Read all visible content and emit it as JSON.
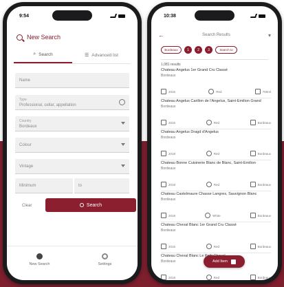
{
  "colors": {
    "accent": "#8b1e2f",
    "band_bottom": "#7e1f2e"
  },
  "left": {
    "status_time": "9:54",
    "header_title": "New Search",
    "tabs": [
      {
        "label": "Search",
        "icon": "magnifier-icon",
        "active": true
      },
      {
        "label": "Advanced list",
        "icon": "list-icon",
        "active": false
      }
    ],
    "fields": [
      {
        "placeholder": "Name"
      },
      {
        "label": "Type",
        "value": "Professional, cellar, appellation"
      },
      {
        "label": "Country",
        "value": "Bordeaux"
      },
      {
        "placeholder": "Colour"
      },
      {
        "placeholder": "Vintage"
      }
    ],
    "range": {
      "from": "Minimum",
      "to": "to"
    },
    "clear_label": "Clear",
    "search_label": "Search",
    "nav": [
      {
        "label": "New Search",
        "icon": "search-icon"
      },
      {
        "label": "Settings",
        "icon": "gear-icon"
      }
    ]
  },
  "right": {
    "status_time": "10:38",
    "title": "Search Results",
    "chips": [
      "Bordeaux",
      "1",
      "2",
      "3",
      "Search to"
    ],
    "results_count": "1,081 results",
    "results": [
      {
        "name": "Chateau Angelus 1er Grand Cru Classé",
        "region": "Bordeaux",
        "m1": "2015",
        "m2": "Red",
        "m3": "750ml"
      },
      {
        "name": "Chateau Angelus Carillon de l'Angelus, Saint-Emilion Grand",
        "region": "Bordeaux",
        "m1": "2016",
        "m2": "Red",
        "m3": "Bordeaux"
      },
      {
        "name": "Chateau Angelus Dragd d'Angelus",
        "region": "Bordeaux",
        "m1": "2018",
        "m2": "Red",
        "m3": "Bordeaux"
      },
      {
        "name": "Chateau Bonne Cuisinerie Blanc de Blanc, Saint-Emilion",
        "region": "Bordeaux",
        "m1": "2018",
        "m2": "Red",
        "m3": "Bordeaux"
      },
      {
        "name": "Chateau Castelmaure Chasse Langres, Sauvignon Blanc",
        "region": "Bordeaux",
        "m1": "2019",
        "m2": "White",
        "m3": "Bordeaux"
      },
      {
        "name": "Chateau Cheval Blanc 1er Grand Cru Classé",
        "region": "Bordeaux",
        "m1": "2016",
        "m2": "Red",
        "m3": "Bordeaux"
      },
      {
        "name": "Chateau Cheval Blanc Le Petit Cheval",
        "region": "Bordeaux",
        "m1": "2018",
        "m2": "Red",
        "m3": "Bordeaux"
      }
    ],
    "fab_label": "Add Item"
  }
}
